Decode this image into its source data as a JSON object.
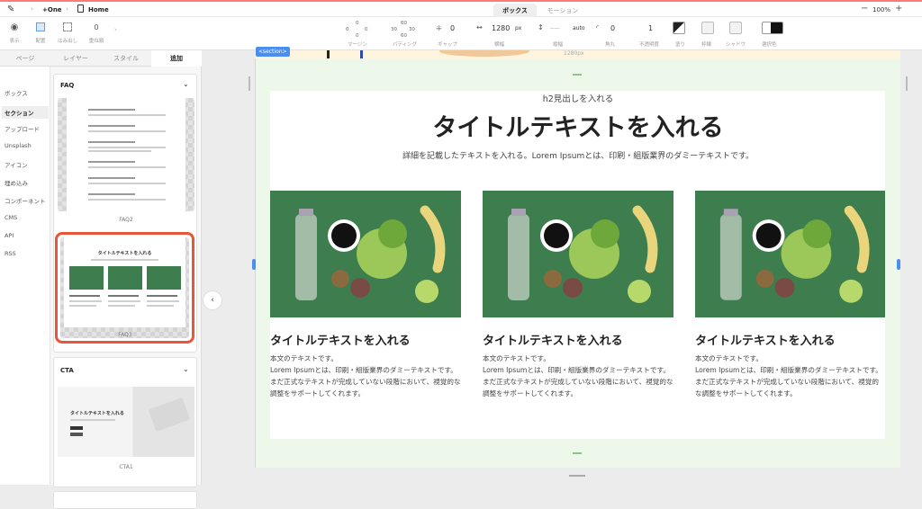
{
  "topbar": {
    "project": "+One",
    "page": "Home",
    "zoom": "100%",
    "tab_box": "ボックス",
    "tab_motion": "モーション"
  },
  "toolbar": {
    "display": "表示",
    "layout": "配置",
    "overflow": "はみ出し",
    "stack_value": "0",
    "stack": "重ね順",
    "margin_label": "マージン",
    "margin_top": "0",
    "margin_left": "0",
    "margin_right": "0",
    "margin_bottom": "0",
    "padding_label": "パディング",
    "padding_top": "60",
    "padding_left": "30",
    "padding_right": "30",
    "padding_bottom": "60",
    "gap_label": "ギャップ",
    "gap_value": "0",
    "width_label": "横幅",
    "width_value": "1280",
    "width_unit": "px",
    "height_label": "縦幅",
    "height_value": "-----",
    "height_unit": "auto",
    "radius_label": "角丸",
    "radius_value": "0",
    "opacity_label": "不透明度",
    "opacity_value": "1",
    "fill_label": "塗り",
    "border_label": "枠線",
    "shadow_label": "シャドウ",
    "selected_color_label": "選択色"
  },
  "panel_tabs": [
    "ページ",
    "レイヤー",
    "スタイル",
    "追加"
  ],
  "categories": [
    "ボックス",
    "セクション",
    "アップロード",
    "Unsplash",
    "アイコン",
    "埋め込み",
    "コンポーネント",
    "CMS",
    "API",
    "RSS"
  ],
  "panel": {
    "faq_heading": "FAQ",
    "faq2_caption": "FAQ2",
    "faq3_caption": "FAQ3",
    "faq3_thumb_title": "タイトルテキストを入れる",
    "cta_heading": "CTA",
    "cta1_caption": "CTA1",
    "cta1_thumb_title": "タイトルテキストを入れる"
  },
  "canvas": {
    "section_tag": "<section>",
    "width_badge": "1280px",
    "h2_label": "h2見出しを入れる",
    "title": "タイトルテキストを入れる",
    "description": "詳細を記載したテキストを入れる。Lorem Ipsumとは、印刷・組版業界のダミーテキストです。",
    "columns": [
      {
        "title": "タイトルテキストを入れる",
        "body": "本文のテキストです。\nLorem Ipsumとは、印刷・組版業界のダミーテキストです。\nまだ正式なテキストが完成していない段階において、視覚的な調整をサポートしてくれます。"
      },
      {
        "title": "タイトルテキストを入れる",
        "body": "本文のテキストです。\nLorem Ipsumとは、印刷・組版業界のダミーテキストです。\nまだ正式なテキストが完成していない段階において、視覚的な調整をサポートしてくれます。"
      },
      {
        "title": "タイトルテキストを入れる",
        "body": "本文のテキストです。\nLorem Ipsumとは、印刷・組版業界のダミーテキストです。\nまだ正式なテキストが完成していない段階において、視覚的な調整をサポートしてくれます。"
      }
    ]
  },
  "colors": {
    "accent": "#4a8ef0",
    "highlight": "#e8563a",
    "photo_bg": "#3d7d4e",
    "band": "#eef8ea"
  }
}
